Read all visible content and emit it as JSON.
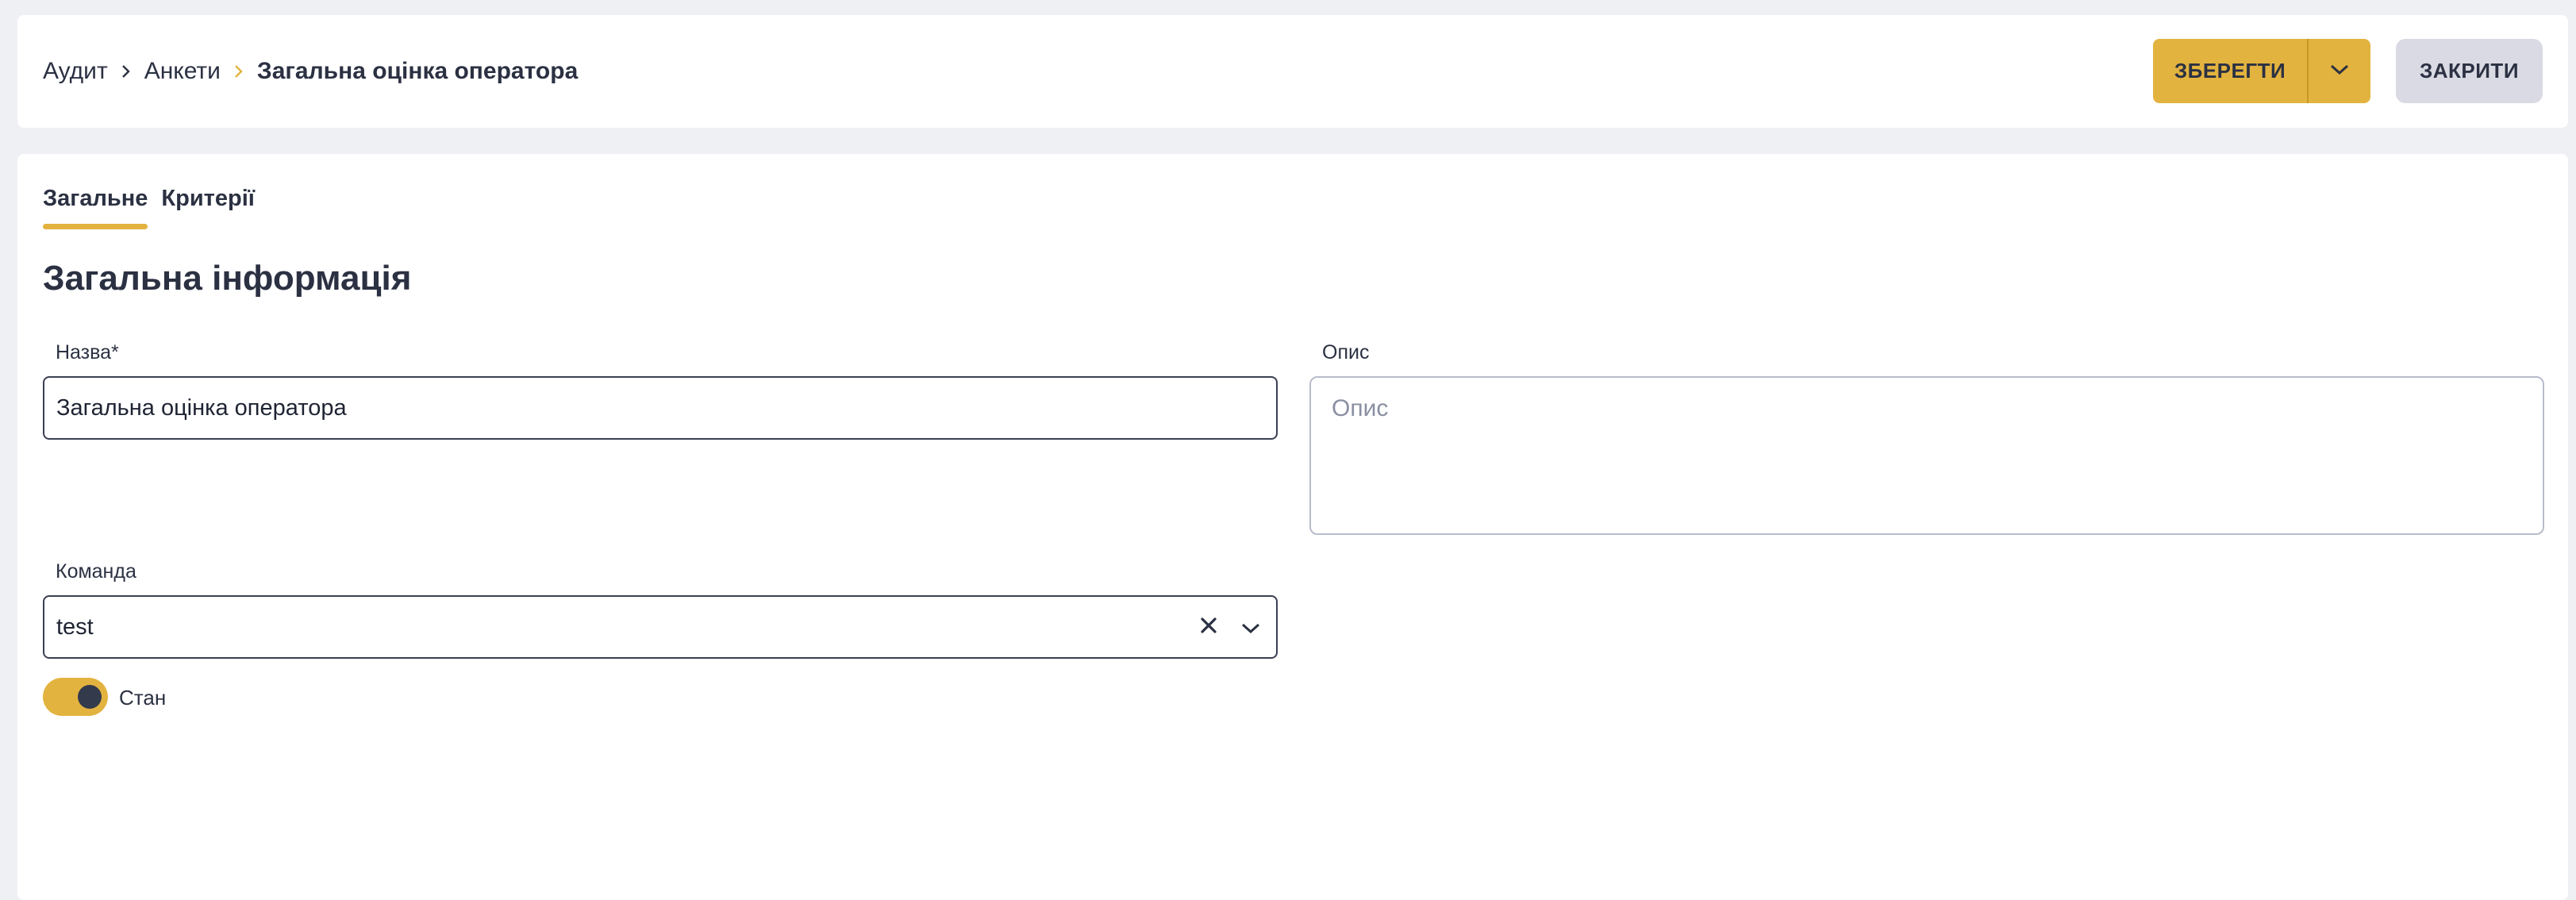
{
  "breadcrumb": {
    "items": [
      "Аудит",
      "Анкети"
    ],
    "current": "Загальна оцінка оператора"
  },
  "toolbar": {
    "save_label": "ЗБЕРЕГТИ",
    "close_label": "ЗАКРИТИ"
  },
  "tabs": [
    {
      "label": "Загальне",
      "active": true
    },
    {
      "label": "Критерії",
      "active": false
    }
  ],
  "section_title": "Загальна інформація",
  "form": {
    "name_label": "Назва*",
    "name_value": "Загальна оцінка оператора",
    "description_label": "Опис",
    "description_placeholder": "Опис",
    "team_label": "Команда",
    "team_value": "test",
    "status_label": "Стан",
    "status_enabled": true
  },
  "colors": {
    "accent": "#e3b33f",
    "text": "#2b3142",
    "background": "#eff0f4",
    "close_button": "#d9dae3"
  }
}
